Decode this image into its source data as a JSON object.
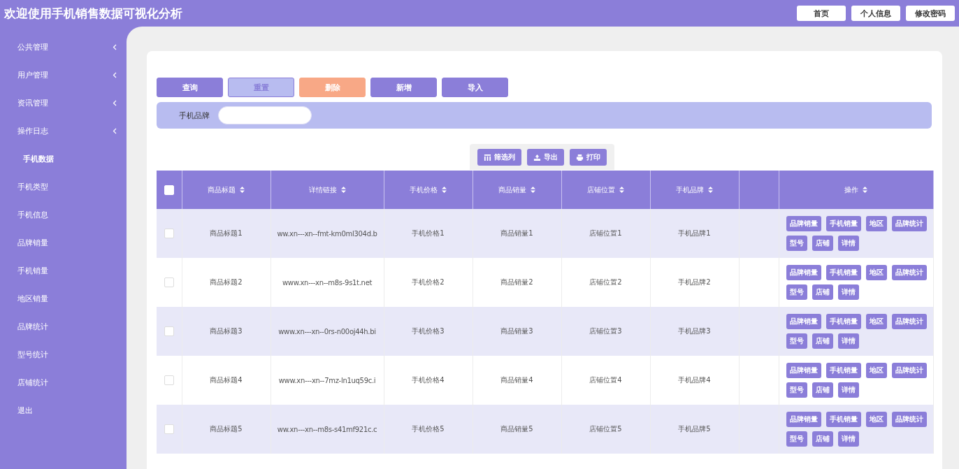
{
  "header": {
    "title": "欢迎使用手机销售数据可视化分析",
    "buttons": [
      "首页",
      "个人信息",
      "修改密码"
    ]
  },
  "sidebar": {
    "items": [
      {
        "label": "公共管理",
        "expandable": true,
        "selected": false
      },
      {
        "label": "用户管理",
        "expandable": true,
        "selected": false
      },
      {
        "label": "资讯管理",
        "expandable": true,
        "selected": false
      },
      {
        "label": "操作日志",
        "expandable": true,
        "selected": false
      },
      {
        "label": "手机数据",
        "expandable": false,
        "selected": true
      },
      {
        "label": "手机类型",
        "expandable": false,
        "selected": false
      },
      {
        "label": "手机信息",
        "expandable": false,
        "selected": false
      },
      {
        "label": "品牌销量",
        "expandable": false,
        "selected": false
      },
      {
        "label": "手机销量",
        "expandable": false,
        "selected": false
      },
      {
        "label": "地区销量",
        "expandable": false,
        "selected": false
      },
      {
        "label": "品牌统计",
        "expandable": false,
        "selected": false
      },
      {
        "label": "型号统计",
        "expandable": false,
        "selected": false
      },
      {
        "label": "店铺统计",
        "expandable": false,
        "selected": false
      },
      {
        "label": "退出",
        "expandable": false,
        "selected": false
      }
    ]
  },
  "actions": [
    {
      "label": "查询",
      "kind": "primary"
    },
    {
      "label": "重置",
      "kind": "light"
    },
    {
      "label": "删除",
      "kind": "danger"
    },
    {
      "label": "新增",
      "kind": "primary"
    },
    {
      "label": "导入",
      "kind": "primary"
    }
  ],
  "search": {
    "label": "手机品牌"
  },
  "table_tools": [
    {
      "label": "筛选列",
      "kind": "columns"
    },
    {
      "label": "导出",
      "kind": "export"
    },
    {
      "label": "打印",
      "kind": "print"
    }
  ],
  "table": {
    "select_all_checked": false,
    "columns": [
      {
        "label": "商品标题"
      },
      {
        "label": "详情链接"
      },
      {
        "label": "手机价格"
      },
      {
        "label": "商品销量"
      },
      {
        "label": "店铺位置"
      },
      {
        "label": "手机品牌"
      },
      {},
      {
        "label": "操作"
      }
    ],
    "rows": [
      {
        "checked": false,
        "cells": [
          "商品标题1",
          "ww.xn---xn--fmt-km0ml304d.b",
          "手机价格1",
          "商品销量1",
          "店铺位置1",
          "手机品牌1"
        ],
        "ops": [
          "品牌销量",
          "手机销量",
          "地区",
          "品牌统计",
          "型号",
          "店铺",
          "详情"
        ]
      },
      {
        "checked": false,
        "cells": [
          "商品标题2",
          "www.xn---xn--m8s-9s1t.net",
          "手机价格2",
          "商品销量2",
          "店铺位置2",
          "手机品牌2"
        ],
        "ops": [
          "品牌销量",
          "手机销量",
          "地区",
          "品牌统计",
          "型号",
          "店铺",
          "详情"
        ]
      },
      {
        "checked": false,
        "cells": [
          "商品标题3",
          "www.xn---xn--0rs-n00oj44h.bi",
          "手机价格3",
          "商品销量3",
          "店铺位置3",
          "手机品牌3"
        ],
        "ops": [
          "品牌销量",
          "手机销量",
          "地区",
          "品牌统计",
          "型号",
          "店铺",
          "详情"
        ]
      },
      {
        "checked": false,
        "cells": [
          "商品标题4",
          "www.xn---xn--7mz-ln1uq59c.i",
          "手机价格4",
          "商品销量4",
          "店铺位置4",
          "手机品牌4"
        ],
        "ops": [
          "品牌销量",
          "手机销量",
          "地区",
          "品牌统计",
          "型号",
          "店铺",
          "详情"
        ]
      },
      {
        "checked": false,
        "cells": [
          "商品标题5",
          "ww.xn---xn--m8s-s41mf921c.c",
          "手机价格5",
          "商品销量5",
          "店铺位置5",
          "手机品牌5"
        ],
        "ops": [
          "品牌销量",
          "手机销量",
          "地区",
          "品牌统计",
          "型号",
          "店铺",
          "详情"
        ]
      }
    ]
  }
}
